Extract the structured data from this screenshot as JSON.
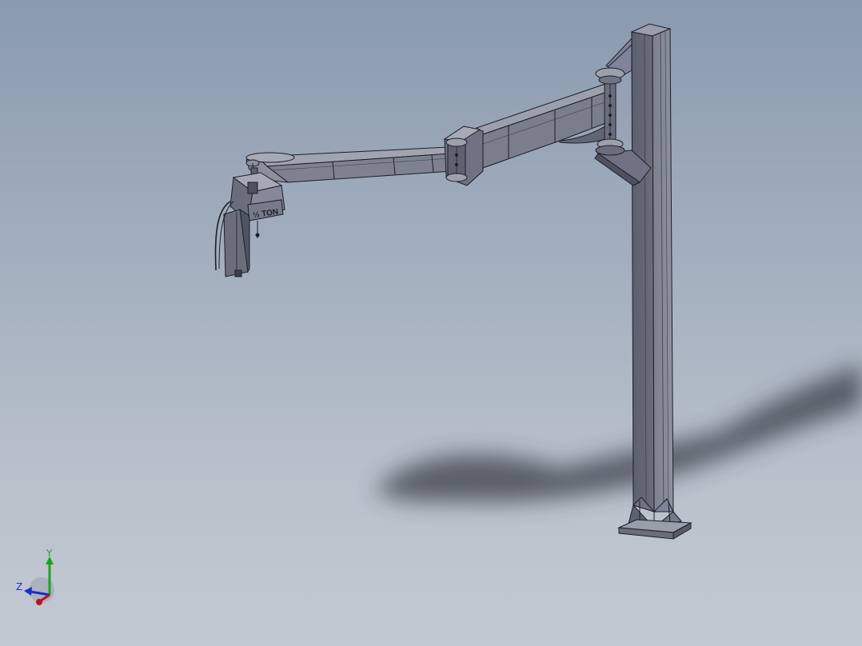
{
  "hoist": {
    "capacity_label": "½ TON"
  },
  "triad": {
    "axis_y_label": "Y",
    "axis_z_label": "Z",
    "color_x": "#c0101a",
    "color_y": "#1aa324",
    "color_z": "#1a2fc0"
  },
  "colors": {
    "background_top": "#8a9aae",
    "background_bottom": "#c3c9d2",
    "steel_light": "#8c909e",
    "steel_mid": "#6e7282",
    "steel_dark": "#4a4e5c",
    "edge": "#1c1e26",
    "shadow": "#3a3e48"
  },
  "icons": [
    "jib-crane-model",
    "view-orientation-triad-icon"
  ]
}
